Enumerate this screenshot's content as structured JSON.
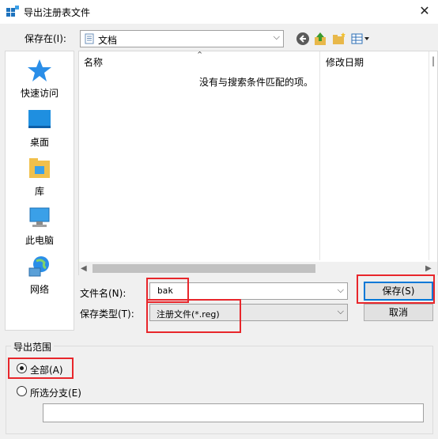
{
  "window": {
    "title": "导出注册表文件",
    "close_glyph": "✕"
  },
  "toolbar": {
    "save_in_label": "保存在(I):",
    "location": "文档",
    "icons": [
      "back-icon",
      "up-folder-icon",
      "new-folder-icon",
      "view-menu-icon"
    ]
  },
  "places": [
    {
      "label": "快速访问",
      "icon": "quick-access-star-icon"
    },
    {
      "label": "桌面",
      "icon": "desktop-icon"
    },
    {
      "label": "库",
      "icon": "library-icon"
    },
    {
      "label": "此电脑",
      "icon": "this-pc-icon"
    },
    {
      "label": "网络",
      "icon": "network-icon"
    }
  ],
  "file_list": {
    "columns": [
      "名称",
      "修改日期"
    ],
    "empty_message": "没有与搜索条件匹配的项。"
  },
  "filename": {
    "label": "文件名(N):",
    "value": "bak"
  },
  "filetype": {
    "label": "保存类型(T):",
    "value": "注册文件(*.reg)"
  },
  "buttons": {
    "save": "保存(S)",
    "cancel": "取消"
  },
  "export_range": {
    "title": "导出范围",
    "all_label": "全部(A)",
    "all_selected": true,
    "branch_label": "所选分支(E)",
    "branch_value": ""
  },
  "colors": {
    "accent": "#0078d7",
    "highlight": "#e8262b"
  }
}
